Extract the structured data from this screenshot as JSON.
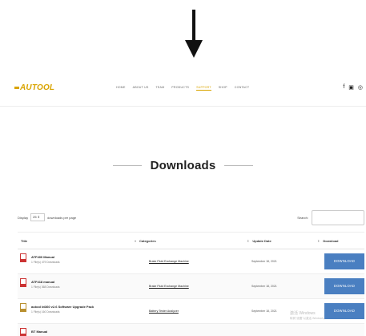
{
  "brand": {
    "logo_text": "AUTOOL",
    "accent": "#d9a400"
  },
  "nav": {
    "items": [
      {
        "label": "HOME",
        "active": false
      },
      {
        "label": "ABOUT US",
        "active": false
      },
      {
        "label": "TEAM",
        "active": false
      },
      {
        "label": "PRODUCTS",
        "active": false
      },
      {
        "label": "SUPPORT",
        "active": true
      },
      {
        "label": "SHOP",
        "active": false
      },
      {
        "label": "CONTACT",
        "active": false
      }
    ],
    "social": [
      "f",
      "▣",
      "◎"
    ]
  },
  "page": {
    "title": "Downloads"
  },
  "controls": {
    "display_prefix": "Display",
    "per_page_value": "25 ⇕",
    "display_suffix": "downloads per page",
    "search_label": "Search:",
    "search_placeholder": ""
  },
  "table": {
    "headers": {
      "title": "Title",
      "categories": "Categories",
      "update_date": "Update Date",
      "download": "Download"
    },
    "rows": [
      {
        "name": "ATF400 Manual",
        "meta": "1 File(s)  479 Downloads",
        "category": "Brake Fluid Exchange Machine",
        "date": "September 18, 2021",
        "button": "DOWNLOAD",
        "icon": "pdf-icon"
      },
      {
        "name": "ATF418 manual",
        "meta": "1 File(s)  368 Downloads",
        "category": "Brake Fluid Exchange Machine",
        "date": "September 18, 2021",
        "button": "DOWNLOAD",
        "icon": "pdf-icon"
      },
      {
        "name": "autool bt360 v2.6 Software Upgrade Pack",
        "meta": "1 File(s)  160 Downloads",
        "category": "Battery Tester Analyzer",
        "date": "September 18, 2021",
        "button": "DOWNLOAD",
        "icon": "zip-icon"
      },
      {
        "name": "BT Manual",
        "meta": "",
        "category": "",
        "date": "",
        "button": "",
        "icon": "pdf-icon"
      }
    ]
  },
  "watermark": {
    "line1": "激活 Windows",
    "line2": "转到\"设置\"以激活 Windows。"
  }
}
